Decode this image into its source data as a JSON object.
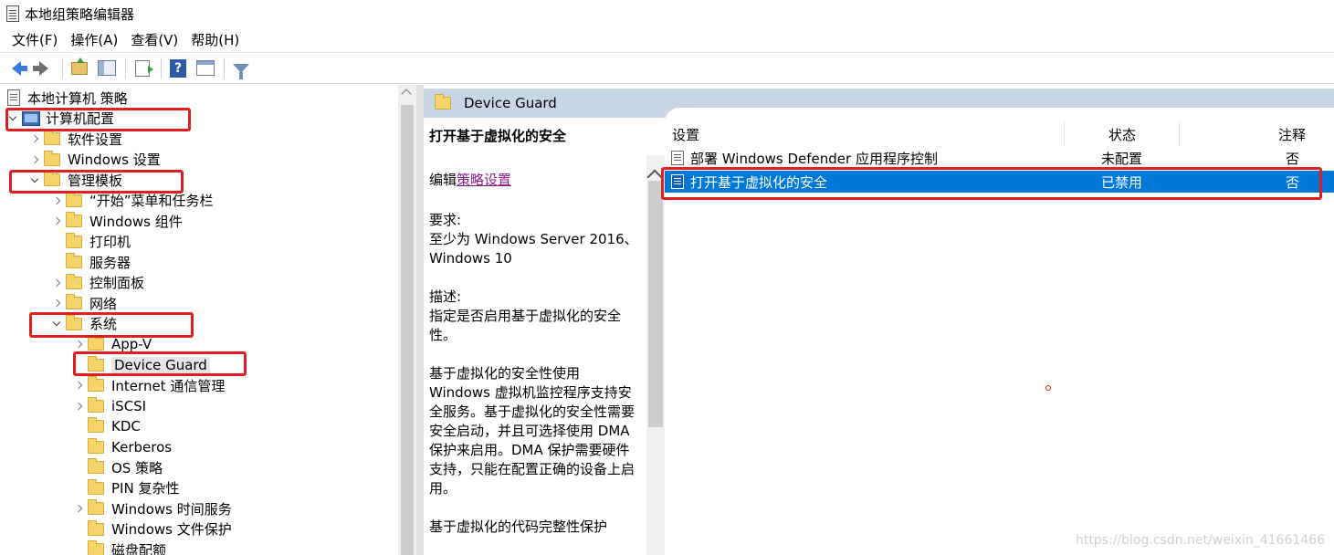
{
  "window": {
    "title": "本地组策略编辑器"
  },
  "menu": [
    "文件(F)",
    "操作(A)",
    "查看(V)",
    "帮助(H)"
  ],
  "toolbar": {
    "icons": [
      "back-icon",
      "forward-icon",
      "folder-up-icon",
      "show-tree-icon",
      "export-list-icon",
      "help-icon",
      "properties-icon",
      "filter-icon"
    ],
    "help_glyph": "?"
  },
  "tree": [
    {
      "label": "本地计算机 策略",
      "level": 0,
      "chevron": "none",
      "icon": "doc"
    },
    {
      "label": "计算机配置",
      "level": 0,
      "chevron": "down",
      "icon": "pc"
    },
    {
      "label": "软件设置",
      "level": 1,
      "chevron": "right",
      "icon": "folder"
    },
    {
      "label": "Windows 设置",
      "level": 1,
      "chevron": "right",
      "icon": "folder"
    },
    {
      "label": "管理模板",
      "level": 1,
      "chevron": "down",
      "icon": "folder"
    },
    {
      "label": "“开始”菜单和任务栏",
      "level": 2,
      "chevron": "right",
      "icon": "folder"
    },
    {
      "label": "Windows 组件",
      "level": 2,
      "chevron": "right",
      "icon": "folder"
    },
    {
      "label": "打印机",
      "level": 2,
      "chevron": "none",
      "icon": "folder"
    },
    {
      "label": "服务器",
      "level": 2,
      "chevron": "none",
      "icon": "folder"
    },
    {
      "label": "控制面板",
      "level": 2,
      "chevron": "right",
      "icon": "folder"
    },
    {
      "label": "网络",
      "level": 2,
      "chevron": "right",
      "icon": "folder"
    },
    {
      "label": "系统",
      "level": 2,
      "chevron": "down",
      "icon": "folder"
    },
    {
      "label": "App-V",
      "level": 3,
      "chevron": "right",
      "icon": "folder"
    },
    {
      "label": "Device Guard",
      "level": 3,
      "chevron": "none",
      "icon": "folder",
      "selected": true
    },
    {
      "label": "Internet 通信管理",
      "level": 3,
      "chevron": "right",
      "icon": "folder"
    },
    {
      "label": "iSCSI",
      "level": 3,
      "chevron": "right",
      "icon": "folder"
    },
    {
      "label": "KDC",
      "level": 3,
      "chevron": "none",
      "icon": "folder"
    },
    {
      "label": "Kerberos",
      "level": 3,
      "chevron": "none",
      "icon": "folder"
    },
    {
      "label": "OS 策略",
      "level": 3,
      "chevron": "none",
      "icon": "folder"
    },
    {
      "label": "PIN 复杂性",
      "level": 3,
      "chevron": "none",
      "icon": "folder"
    },
    {
      "label": "Windows 时间服务",
      "level": 3,
      "chevron": "right",
      "icon": "folder"
    },
    {
      "label": "Windows 文件保护",
      "level": 3,
      "chevron": "none",
      "icon": "folder"
    },
    {
      "label": "磁盘配额",
      "level": 3,
      "chevron": "none",
      "icon": "folder"
    }
  ],
  "right_header": {
    "title": "Device Guard"
  },
  "description": {
    "title": "打开基于虚拟化的安全",
    "edit_prefix": "编辑",
    "edit_link": "策略设置",
    "requirements_label": "要求:",
    "requirements": "至少为 Windows Server 2016、Windows 10",
    "desc_label": "描述:",
    "desc_line": "指定是否启用基于虚拟化的安全性。",
    "desc_para": "基于虚拟化的安全性使用 Windows 虚拟机监控程序支持安全服务。基于虚拟化的安全性需要安全启动，并且可选择使用 DMA 保护来启用。DMA 保护需要硬件支持，只能在配置正确的设备上启用。",
    "desc_tail": "基于虚拟化的代码完整性保护"
  },
  "list": {
    "columns": {
      "setting": "设置",
      "state": "状态",
      "comment": "注释"
    },
    "rows": [
      {
        "setting": "部署 Windows Defender 应用程序控制",
        "state": "未配置",
        "comment": "否",
        "selected": false
      },
      {
        "setting": "打开基于虚拟化的安全",
        "state": "已禁用",
        "comment": "否",
        "selected": true
      }
    ]
  },
  "watermark": "https://blog.csdn.net/weixin_41661466",
  "colors": {
    "selection": "#0078d7",
    "header_bg": "#c9d6e6",
    "annotation": "#e02020",
    "link": "#8b1d8b"
  }
}
